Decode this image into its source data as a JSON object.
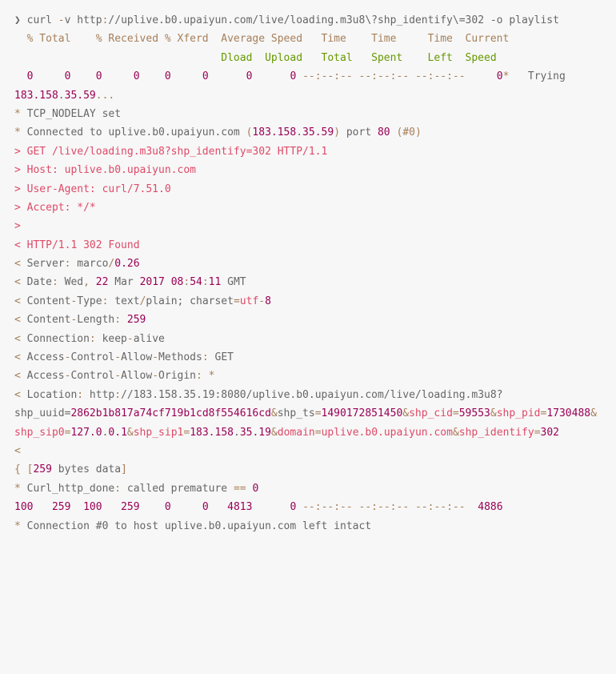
{
  "code_block": {
    "lines": [
      {
        "type": "plain",
        "segments": [
          {
            "text": "❯ curl ",
            "cls": ""
          },
          {
            "text": "-",
            "cls": "token-operator"
          },
          {
            "text": "v http",
            "cls": ""
          },
          {
            "text": ":",
            "cls": "token-operator"
          },
          {
            "text": "//uplive.b0.upaiyun.com/live/loading.m3u8\\?shp_identify\\=302 -o playlist",
            "cls": ""
          }
        ]
      },
      {
        "type": "plain",
        "segments": [
          {
            "text": "  ",
            "cls": ""
          },
          {
            "text": "% Total    % Received % Xferd  Average Speed   Time    Time     Time  Current",
            "cls": "token-operator"
          }
        ]
      },
      {
        "type": "plain",
        "segments": [
          {
            "text": "                                 ",
            "cls": ""
          },
          {
            "text": "Dload  Upload   Total   Spent    Left  Speed",
            "cls": "token-property"
          }
        ]
      },
      {
        "type": "plain",
        "segments": [
          {
            "text": "  ",
            "cls": ""
          },
          {
            "text": "0",
            "cls": "token-number"
          },
          {
            "text": "     ",
            "cls": ""
          },
          {
            "text": "0",
            "cls": "token-number"
          },
          {
            "text": "    ",
            "cls": ""
          },
          {
            "text": "0",
            "cls": "token-number"
          },
          {
            "text": "     ",
            "cls": ""
          },
          {
            "text": "0",
            "cls": "token-number"
          },
          {
            "text": "    ",
            "cls": ""
          },
          {
            "text": "0",
            "cls": "token-number"
          },
          {
            "text": "     ",
            "cls": ""
          },
          {
            "text": "0",
            "cls": "token-number"
          },
          {
            "text": "      ",
            "cls": ""
          },
          {
            "text": "0",
            "cls": "token-number"
          },
          {
            "text": "      ",
            "cls": ""
          },
          {
            "text": "0",
            "cls": "token-number"
          },
          {
            "text": " ",
            "cls": ""
          },
          {
            "text": "--:--:-- --:--:-- --:--:--     ",
            "cls": "token-operator"
          },
          {
            "text": "0",
            "cls": "token-number"
          },
          {
            "text": "*",
            "cls": "token-operator"
          },
          {
            "text": "   Trying ",
            "cls": ""
          },
          {
            "text": "183.158",
            "cls": "token-number"
          },
          {
            "text": ".",
            "cls": ""
          },
          {
            "text": "35.59",
            "cls": "token-number"
          },
          {
            "text": "...",
            "cls": "token-operator"
          }
        ]
      },
      {
        "type": "plain",
        "segments": [
          {
            "text": "*",
            "cls": "token-operator"
          },
          {
            "text": " TCP_NODELAY set",
            "cls": ""
          }
        ]
      },
      {
        "type": "plain",
        "segments": [
          {
            "text": "*",
            "cls": "token-operator"
          },
          {
            "text": " Connected to uplive.b0.upaiyun.com ",
            "cls": ""
          },
          {
            "text": "(",
            "cls": "token-operator"
          },
          {
            "text": "183.158",
            "cls": "token-number"
          },
          {
            "text": ".",
            "cls": ""
          },
          {
            "text": "35.59",
            "cls": "token-number"
          },
          {
            "text": ")",
            "cls": "token-operator"
          },
          {
            "text": " port ",
            "cls": ""
          },
          {
            "text": "80",
            "cls": "token-number"
          },
          {
            "text": " ",
            "cls": ""
          },
          {
            "text": "(#0)",
            "cls": "token-operator"
          }
        ]
      },
      {
        "type": "function",
        "segments": [
          {
            "text": "> GET /live/loading.m3u8?shp_identify=302 HTTP/1.1",
            "cls": "token-function"
          }
        ]
      },
      {
        "type": "function",
        "segments": [
          {
            "text": "> Host: uplive.b0.upaiyun.com",
            "cls": "token-function"
          }
        ]
      },
      {
        "type": "function",
        "segments": [
          {
            "text": "> User-Agent: curl/7.51.0",
            "cls": "token-function"
          }
        ]
      },
      {
        "type": "function",
        "segments": [
          {
            "text": "> Accept: */*",
            "cls": "token-function"
          }
        ]
      },
      {
        "type": "function",
        "segments": [
          {
            "text": ">",
            "cls": "token-function"
          }
        ]
      },
      {
        "type": "function",
        "segments": [
          {
            "text": "< HTTP/1.1 302 Found",
            "cls": "token-function"
          }
        ]
      },
      {
        "type": "plain",
        "segments": [
          {
            "text": "<",
            "cls": "token-operator"
          },
          {
            "text": " Server",
            "cls": ""
          },
          {
            "text": ":",
            "cls": "token-operator"
          },
          {
            "text": " marco",
            "cls": ""
          },
          {
            "text": "/",
            "cls": "token-operator"
          },
          {
            "text": "0.26",
            "cls": "token-number"
          }
        ]
      },
      {
        "type": "plain",
        "segments": [
          {
            "text": "<",
            "cls": "token-operator"
          },
          {
            "text": " Date",
            "cls": ""
          },
          {
            "text": ":",
            "cls": "token-operator"
          },
          {
            "text": " Wed",
            "cls": ""
          },
          {
            "text": ",",
            "cls": "token-operator"
          },
          {
            "text": " ",
            "cls": ""
          },
          {
            "text": "22",
            "cls": "token-number"
          },
          {
            "text": " Mar ",
            "cls": ""
          },
          {
            "text": "2017",
            "cls": "token-number"
          },
          {
            "text": " ",
            "cls": ""
          },
          {
            "text": "08",
            "cls": "token-number"
          },
          {
            "text": ":",
            "cls": "token-operator"
          },
          {
            "text": "54",
            "cls": "token-number"
          },
          {
            "text": ":",
            "cls": "token-operator"
          },
          {
            "text": "11",
            "cls": "token-number"
          },
          {
            "text": " GMT",
            "cls": ""
          }
        ]
      },
      {
        "type": "plain",
        "segments": [
          {
            "text": "<",
            "cls": "token-operator"
          },
          {
            "text": " Content",
            "cls": ""
          },
          {
            "text": "-",
            "cls": "token-operator"
          },
          {
            "text": "Type",
            "cls": ""
          },
          {
            "text": ":",
            "cls": "token-operator"
          },
          {
            "text": " text",
            "cls": ""
          },
          {
            "text": "/",
            "cls": "token-operator"
          },
          {
            "text": "plain; charset",
            "cls": ""
          },
          {
            "text": "=",
            "cls": "token-operator"
          },
          {
            "text": "utf",
            "cls": "token-function"
          },
          {
            "text": "-",
            "cls": "token-operator"
          },
          {
            "text": "8",
            "cls": "token-number"
          }
        ]
      },
      {
        "type": "plain",
        "segments": [
          {
            "text": "<",
            "cls": "token-operator"
          },
          {
            "text": " Content",
            "cls": ""
          },
          {
            "text": "-",
            "cls": "token-operator"
          },
          {
            "text": "Length",
            "cls": ""
          },
          {
            "text": ":",
            "cls": "token-operator"
          },
          {
            "text": " ",
            "cls": ""
          },
          {
            "text": "259",
            "cls": "token-number"
          }
        ]
      },
      {
        "type": "plain",
        "segments": [
          {
            "text": "<",
            "cls": "token-operator"
          },
          {
            "text": " Connection",
            "cls": ""
          },
          {
            "text": ":",
            "cls": "token-operator"
          },
          {
            "text": " keep",
            "cls": ""
          },
          {
            "text": "-",
            "cls": "token-operator"
          },
          {
            "text": "alive",
            "cls": ""
          }
        ]
      },
      {
        "type": "plain",
        "segments": [
          {
            "text": "<",
            "cls": "token-operator"
          },
          {
            "text": " Access",
            "cls": ""
          },
          {
            "text": "-",
            "cls": "token-operator"
          },
          {
            "text": "Control",
            "cls": ""
          },
          {
            "text": "-",
            "cls": "token-operator"
          },
          {
            "text": "Allow",
            "cls": ""
          },
          {
            "text": "-",
            "cls": "token-operator"
          },
          {
            "text": "Methods",
            "cls": ""
          },
          {
            "text": ":",
            "cls": "token-operator"
          },
          {
            "text": " GET",
            "cls": ""
          }
        ]
      },
      {
        "type": "plain",
        "segments": [
          {
            "text": "<",
            "cls": "token-operator"
          },
          {
            "text": " Access",
            "cls": ""
          },
          {
            "text": "-",
            "cls": "token-operator"
          },
          {
            "text": "Control",
            "cls": ""
          },
          {
            "text": "-",
            "cls": "token-operator"
          },
          {
            "text": "Allow",
            "cls": ""
          },
          {
            "text": "-",
            "cls": "token-operator"
          },
          {
            "text": "Origin",
            "cls": ""
          },
          {
            "text": ":",
            "cls": "token-operator"
          },
          {
            "text": " ",
            "cls": ""
          },
          {
            "text": "*",
            "cls": "token-operator"
          }
        ]
      },
      {
        "type": "plain",
        "segments": [
          {
            "text": "<",
            "cls": "token-operator"
          },
          {
            "text": " Location",
            "cls": ""
          },
          {
            "text": ":",
            "cls": "token-operator"
          },
          {
            "text": " http",
            "cls": ""
          },
          {
            "text": ":",
            "cls": "token-operator"
          },
          {
            "text": "//183.158.35.19:8080/uplive.b0.upaiyun.com/live/loading.m3u8?shp_uuid=",
            "cls": ""
          },
          {
            "text": "2862b1b817a74cf719b1cd8f554616cd",
            "cls": "token-number"
          },
          {
            "text": "&",
            "cls": "token-operator"
          },
          {
            "text": "shp_ts",
            "cls": ""
          },
          {
            "text": "=",
            "cls": "token-operator"
          },
          {
            "text": "1490172851450",
            "cls": "token-number"
          },
          {
            "text": "&",
            "cls": "token-operator"
          },
          {
            "text": "shp_cid",
            "cls": "token-function"
          },
          {
            "text": "=",
            "cls": "token-operator"
          },
          {
            "text": "59553",
            "cls": "token-number"
          },
          {
            "text": "&",
            "cls": "token-operator"
          },
          {
            "text": "shp_pid",
            "cls": "token-function"
          },
          {
            "text": "=",
            "cls": "token-operator"
          },
          {
            "text": "1730488",
            "cls": "token-number"
          },
          {
            "text": "&",
            "cls": "token-operator"
          },
          {
            "text": "shp_sip0",
            "cls": "token-function"
          },
          {
            "text": "=",
            "cls": "token-operator"
          },
          {
            "text": "127.0",
            "cls": "token-number"
          },
          {
            "text": ".",
            "cls": ""
          },
          {
            "text": "0.1",
            "cls": "token-number"
          },
          {
            "text": "&",
            "cls": "token-operator"
          },
          {
            "text": "shp_sip1",
            "cls": "token-function"
          },
          {
            "text": "=",
            "cls": "token-operator"
          },
          {
            "text": "183.158",
            "cls": "token-number"
          },
          {
            "text": ".",
            "cls": ""
          },
          {
            "text": "35.19",
            "cls": "token-number"
          },
          {
            "text": "&",
            "cls": "token-operator"
          },
          {
            "text": "domain",
            "cls": "token-function"
          },
          {
            "text": "=",
            "cls": "token-operator"
          },
          {
            "text": "uplive.b0.upaiyun.com",
            "cls": "token-function"
          },
          {
            "text": "&",
            "cls": "token-operator"
          },
          {
            "text": "shp_identify",
            "cls": "token-function"
          },
          {
            "text": "=",
            "cls": "token-operator"
          },
          {
            "text": "302",
            "cls": "token-number"
          }
        ]
      },
      {
        "type": "plain",
        "segments": [
          {
            "text": "<",
            "cls": "token-operator"
          }
        ]
      },
      {
        "type": "plain",
        "segments": [
          {
            "text": "{ ",
            "cls": "token-operator"
          },
          {
            "text": "[",
            "cls": "token-operator"
          },
          {
            "text": "259",
            "cls": "token-number"
          },
          {
            "text": " bytes data",
            "cls": ""
          },
          {
            "text": "]",
            "cls": "token-operator"
          }
        ]
      },
      {
        "type": "plain",
        "segments": [
          {
            "text": "*",
            "cls": "token-operator"
          },
          {
            "text": " Curl_http_done",
            "cls": ""
          },
          {
            "text": ":",
            "cls": "token-operator"
          },
          {
            "text": " called premature ",
            "cls": ""
          },
          {
            "text": "==",
            "cls": "token-operator"
          },
          {
            "text": " ",
            "cls": ""
          },
          {
            "text": "0",
            "cls": "token-number"
          }
        ]
      },
      {
        "type": "plain",
        "segments": [
          {
            "text": "100",
            "cls": "token-number"
          },
          {
            "text": "   ",
            "cls": ""
          },
          {
            "text": "259",
            "cls": "token-number"
          },
          {
            "text": "  ",
            "cls": ""
          },
          {
            "text": "100",
            "cls": "token-number"
          },
          {
            "text": "   ",
            "cls": ""
          },
          {
            "text": "259",
            "cls": "token-number"
          },
          {
            "text": "    ",
            "cls": ""
          },
          {
            "text": "0",
            "cls": "token-number"
          },
          {
            "text": "     ",
            "cls": ""
          },
          {
            "text": "0",
            "cls": "token-number"
          },
          {
            "text": "   ",
            "cls": ""
          },
          {
            "text": "4813",
            "cls": "token-number"
          },
          {
            "text": "      ",
            "cls": ""
          },
          {
            "text": "0",
            "cls": "token-number"
          },
          {
            "text": " ",
            "cls": ""
          },
          {
            "text": "--:--:-- --:--:-- --:--:--",
            "cls": "token-operator"
          },
          {
            "text": "  ",
            "cls": ""
          },
          {
            "text": "4886",
            "cls": "token-number"
          }
        ]
      },
      {
        "type": "plain",
        "segments": [
          {
            "text": "*",
            "cls": "token-operator"
          },
          {
            "text": " Connection #0 to host uplive.b0.upaiyun.com left intact",
            "cls": ""
          }
        ]
      }
    ]
  }
}
